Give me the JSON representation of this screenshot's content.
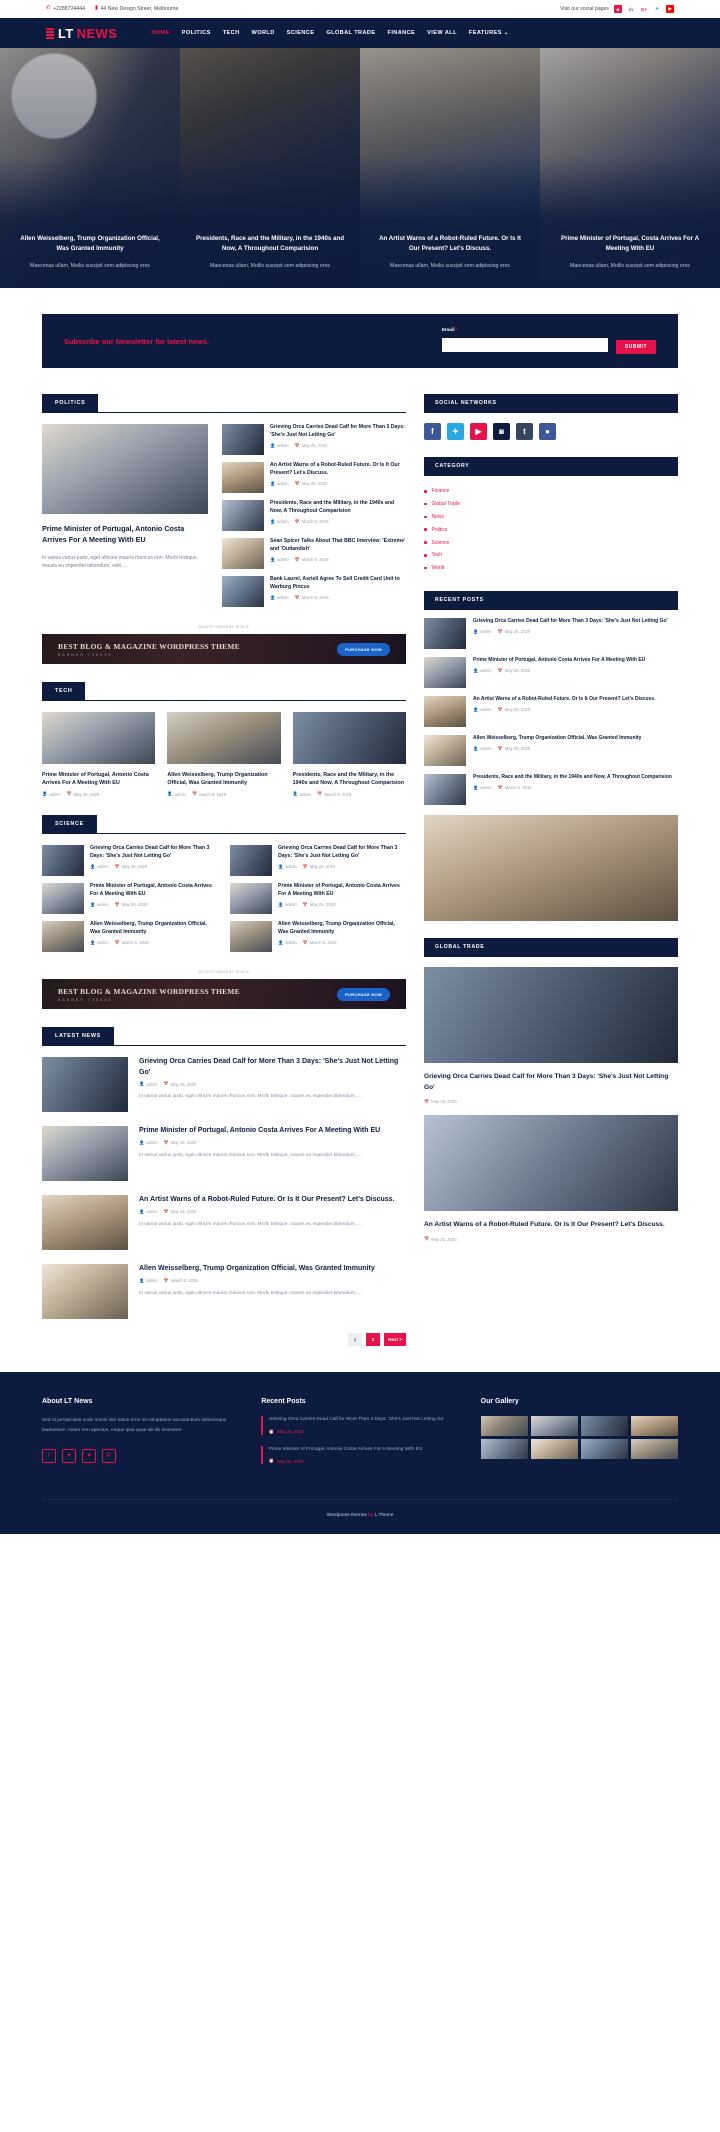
{
  "topbar": {
    "phone": "+2288724444",
    "address": "44 New Design Street, Melbourne",
    "social_text": "Visit our social pages",
    "socials": [
      "instagram-icon",
      "linkedin-icon",
      "googleplus-icon",
      "twitter-icon",
      "youtube-icon"
    ]
  },
  "header": {
    "brand_lt": "LT",
    "brand_news": "NEWS",
    "nav": [
      {
        "label": "HOME",
        "active": true
      },
      {
        "label": "POLITICS",
        "active": false
      },
      {
        "label": "TECH",
        "active": false
      },
      {
        "label": "WORLD",
        "active": false
      },
      {
        "label": "SCIENCE",
        "active": false
      },
      {
        "label": "GLOBAL TRADE",
        "active": false
      },
      {
        "label": "FINANCE",
        "active": false
      },
      {
        "label": "VIEW ALL",
        "active": false
      },
      {
        "label": "FEATURES",
        "active": false
      }
    ]
  },
  "hero": {
    "slides": [
      {
        "title": "Allen Weisselberg, Trump Organization Official, Was Granted Immunity",
        "excerpt": "Maecenas ullam, Mollis suscipit sem adipiscing eros"
      },
      {
        "title": "Presidents, Race and the Military, in the 1940s and Now, A Throughout Comparision",
        "excerpt": "Maecenas ullam, Mollis suscipit sem adipiscing eros"
      },
      {
        "title": "An Artist Warns of a Robot-Ruled Future. Or Is It Our Present? Let's Discuss.",
        "excerpt": "Maecenas ullam, Mollis suscipit sem adipiscing eros"
      },
      {
        "title": "Prime Minister of Portugal, Costa Arrives For A Meeting With EU",
        "excerpt": "Maecenas ullam, Mollis suscipit sem adipiscing eros"
      }
    ]
  },
  "newsletter": {
    "title": "Subscribe our Newsletter for latest news.",
    "email_label": "Email",
    "required_mark": "*",
    "email_value": "",
    "email_placeholder": "",
    "submit_label": "SUBMIT"
  },
  "sections": {
    "politics": "POLITICS",
    "tech": "TECH",
    "science": "SCIENCE",
    "latest": "LATEST NEWS"
  },
  "politics": {
    "feature": {
      "title": "Prime Minister of Portugal, Antonio Costa Arrives For A Meeting With EU",
      "excerpt": "In varius varius justo, eget ultrices mauris rhoncus non. Morbi tristique, mauris eu imperdiet bibendum, velit ..."
    },
    "list": [
      {
        "title": "Grieving Orca Carries Dead Calf for More Than 3 Days: 'She's Just Not Letting Go'",
        "author": "admin",
        "date": "May 25, 2020"
      },
      {
        "title": "An Artist Warns of a Robot-Ruled Future. Or Is It Our Present? Let's Discuss.",
        "author": "admin",
        "date": "May 25, 2020"
      },
      {
        "title": "Presidents, Race and the Military, in the 1940s and Now, A Throughout Comparision",
        "author": "admin",
        "date": "March 6, 2019"
      },
      {
        "title": "Sean Spicer Talks About That BBC Interview: 'Extreme' and 'Outlandish'",
        "author": "admin",
        "date": "March 6, 2019"
      },
      {
        "title": "Bank Laurel, Asriell Agree To Sell Credit Card Unit to Warburg Pincus",
        "author": "admin",
        "date": "March 6, 2019"
      }
    ]
  },
  "ads": {
    "label": "ADVERTISEMENT SPACE",
    "title": "BEST BLOG & MAGAZINE WORDPRESS THEME",
    "sub": "BANNER 728X90",
    "button": "PURCHASE NOW"
  },
  "tech": {
    "cards": [
      {
        "title": "Prime Minister of Portugal, Antonio Costa Arrives For A Meeting With EU",
        "author": "admin",
        "date": "May 25, 2020"
      },
      {
        "title": "Allen Weisselberg, Trump Organization Official, Was Granted Immunity",
        "author": "admin",
        "date": "March 6, 2019"
      },
      {
        "title": "Presidents, Race and the Military, in the 1940s and Now, A Throughout Comparision",
        "author": "admin",
        "date": "March 6, 2019"
      }
    ]
  },
  "science": {
    "items": [
      {
        "title": "Grieving Orca Carries Dead Calf for More Than 3 Days: 'She's Just Not Letting Go'",
        "author": "admin",
        "date": "May 25, 2020"
      },
      {
        "title": "Grieving Orca Carries Dead Calf for More Than 3 Days: 'She's Just Not Letting Go'",
        "author": "admin",
        "date": "May 25, 2020"
      },
      {
        "title": "Prime Minister of Portugal, Antonio Costa Arrives For A Meeting With EU",
        "author": "admin",
        "date": "May 25, 2020"
      },
      {
        "title": "Prime Minister of Portugal, Antonio Costa Arrives For A Meeting With EU",
        "author": "admin",
        "date": "May 25, 2020"
      },
      {
        "title": "Allen Weisselberg, Trump Organization Official, Was Granted Immunity",
        "author": "admin",
        "date": "March 6, 2019"
      },
      {
        "title": "Allen Weisselberg, Trump Organization Official, Was Granted Immunity",
        "author": "admin",
        "date": "March 6, 2019"
      }
    ]
  },
  "latest": {
    "items": [
      {
        "title": "Grieving Orca Carries Dead Calf for More Than 3 Days: 'She's Just Not Letting Go'",
        "author": "admin",
        "date": "May 25, 2020",
        "excerpt": "In varius varius justo, eget ultrices mauris rhoncus non. Morbi tristique, mauris eu imperdiet bibendum, ..."
      },
      {
        "title": "Prime Minister of Portugal, Antonio Costa Arrives For A Meeting With EU",
        "author": "admin",
        "date": "May 25, 2020",
        "excerpt": "In varius varius justo, eget ultrices mauris rhoncus non. Morbi tristique, mauris eu imperdiet bibendum, ..."
      },
      {
        "title": "An Artist Warns of a Robot-Ruled Future. Or Is It Our Present? Let's Discuss.",
        "author": "admin",
        "date": "May 25, 2020",
        "excerpt": "In varius varius justo, eget ultrices mauris rhoncus non. Morbi tristique, mauris eu imperdiet bibendum, ..."
      },
      {
        "title": "Allen Weisselberg, Trump Organization Official, Was Granted Immunity",
        "author": "admin",
        "date": "March 6, 2019",
        "excerpt": "In varius varius justo, eget ultrices mauris rhoncus non. Morbi tristique, mauris eu imperdiet bibendum, ..."
      }
    ],
    "pages": [
      "1",
      "2",
      "Next >"
    ]
  },
  "sidebar": {
    "social_title": "SOCIAL NETWORKS",
    "social_buttons": [
      "facebook-icon",
      "twitter-icon",
      "youtube-icon",
      "instagram-icon",
      "tumblr-icon",
      "dribbble-icon"
    ],
    "category_title": "CATEGORY",
    "categories": [
      "Finance",
      "Global Trade",
      "News",
      "Politics",
      "Science",
      "Tech",
      "World"
    ],
    "recent_title": "RECENT POSTS",
    "recent": [
      {
        "title": "Grieving Orca Carries Dead Calf for More Than 3 Days: 'She's Just Not Letting Go'",
        "author": "admin",
        "date": "May 25, 2020"
      },
      {
        "title": "Prime Minister of Portugal, Antonio Costa Arrives For A Meeting With EU",
        "author": "admin",
        "date": "May 25, 2020"
      },
      {
        "title": "An Artist Warns of a Robot-Ruled Future. Or Is It Our Present? Let's Discuss.",
        "author": "admin",
        "date": "May 25, 2020"
      },
      {
        "title": "Allen Weisselberg, Trump Organization Official, Was Granted Immunity",
        "author": "admin",
        "date": "May 25, 2020"
      },
      {
        "title": "Presidents, Race and the Military, in the 1940s and Now, A Throughout Comparision",
        "author": "admin",
        "date": "March 6, 2019"
      }
    ],
    "global_title": "GLOBAL TRADE",
    "global_cards": [
      {
        "title": "Grieving Orca Carries Dead Calf for More Than 3 Days: 'She's Just Not Letting Go'",
        "date": "May 25, 2020"
      },
      {
        "title": "An Artist Warns of a Robot-Ruled Future. Or Is It Our Present? Let's Discuss.",
        "date": "May 25, 2020"
      }
    ]
  },
  "footer": {
    "about_title": "About LT News",
    "about_text": "Sed ut perspiciatis unde omnis iste natus error sit voluptatem accusantium doloremque laudantium, totam rem aperiam, eaque ipsa quae ab illo inventore.",
    "socials": [
      "facebook-icon",
      "twitter-icon",
      "heart-icon",
      "pinterest-icon"
    ],
    "recent_title": "Recent Posts",
    "recent": [
      {
        "title": "Grieving Orca Carries Dead Calf for More Than 3 Days: 'She's Just Not Letting Go'",
        "date": "May 25, 2020"
      },
      {
        "title": "Prime Minister of Portugal, Antonio Costa Arrives For A Meeting With EU",
        "date": "May 25, 2020"
      }
    ],
    "gallery_title": "Our Gallery",
    "gallery_count": 8,
    "credit_pre": "Wordpress themes",
    "credit_by": "by",
    "credit_brand": "L.Theme"
  },
  "colors": {
    "accent": "#e8124a",
    "navy": "#0d1b3e"
  }
}
